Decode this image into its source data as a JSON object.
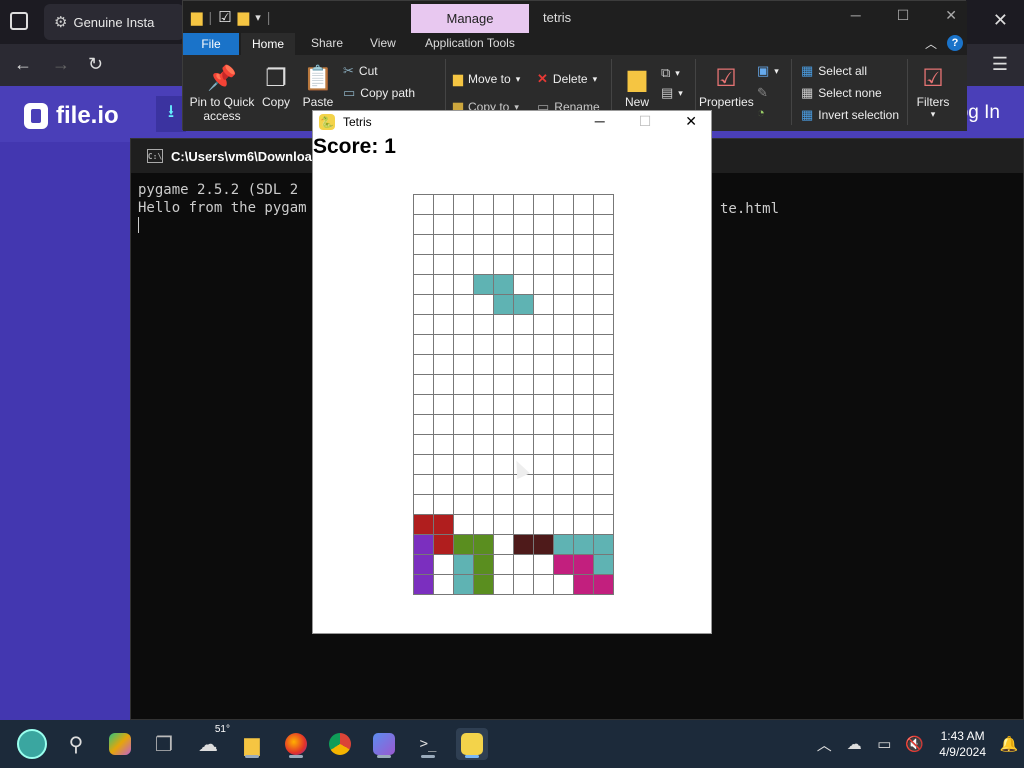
{
  "browser": {
    "tab_title": "Genuine Insta",
    "site_name": "file.io",
    "login_label": "og In"
  },
  "terminal": {
    "title": "C:\\Users\\vm6\\Downloads",
    "icon_label": "C:\\",
    "lines": [
      "pygame 2.5.2 (SDL 2",
      "Hello from the pygam"
    ],
    "tail": "te.html"
  },
  "explorer": {
    "manage_label": "Manage",
    "title": "tetris",
    "tabs": [
      "File",
      "Home",
      "Share",
      "View",
      "Application Tools"
    ],
    "ribbon": {
      "pin_label_1": "Pin to Quick",
      "pin_label_2": "access",
      "copy_label": "Copy",
      "paste_label": "Paste",
      "cut_label": "Cut",
      "copy_path_label": "Copy path",
      "move_to_label": "Move to",
      "copy_to_label": "Copy to",
      "delete_label": "Delete",
      "rename_label": "Rename",
      "new_label": "New",
      "properties_label": "Properties",
      "select_all_label": "Select all",
      "select_none_label": "Select none",
      "invert_selection_label": "Invert selection",
      "filters_label": "Filters"
    }
  },
  "tetris": {
    "window_title": "Tetris",
    "score_text": "Score: 1",
    "rows": 20,
    "cols": 10,
    "colors": {
      "cyan": "#5fb3b3",
      "red": "#b01e1e",
      "purple": "#7b2fbf",
      "green": "#5a8e1f",
      "brown": "#4e1a1a",
      "magenta": "#c21f7e"
    },
    "cells": [
      {
        "r": 4,
        "c": 3,
        "color": "cyan"
      },
      {
        "r": 4,
        "c": 4,
        "color": "cyan"
      },
      {
        "r": 5,
        "c": 4,
        "color": "cyan"
      },
      {
        "r": 5,
        "c": 5,
        "color": "cyan"
      },
      {
        "r": 16,
        "c": 0,
        "color": "red"
      },
      {
        "r": 16,
        "c": 1,
        "color": "red"
      },
      {
        "r": 17,
        "c": 0,
        "color": "purple"
      },
      {
        "r": 17,
        "c": 1,
        "color": "red"
      },
      {
        "r": 17,
        "c": 2,
        "color": "green"
      },
      {
        "r": 17,
        "c": 3,
        "color": "green"
      },
      {
        "r": 17,
        "c": 5,
        "color": "brown"
      },
      {
        "r": 17,
        "c": 6,
        "color": "brown"
      },
      {
        "r": 17,
        "c": 7,
        "color": "cyan"
      },
      {
        "r": 17,
        "c": 8,
        "color": "cyan"
      },
      {
        "r": 17,
        "c": 9,
        "color": "cyan"
      },
      {
        "r": 18,
        "c": 0,
        "color": "purple"
      },
      {
        "r": 18,
        "c": 2,
        "color": "cyan"
      },
      {
        "r": 18,
        "c": 3,
        "color": "green"
      },
      {
        "r": 18,
        "c": 7,
        "color": "magenta"
      },
      {
        "r": 18,
        "c": 8,
        "color": "magenta"
      },
      {
        "r": 18,
        "c": 9,
        "color": "cyan"
      },
      {
        "r": 19,
        "c": 0,
        "color": "purple"
      },
      {
        "r": 19,
        "c": 2,
        "color": "cyan"
      },
      {
        "r": 19,
        "c": 3,
        "color": "green"
      },
      {
        "r": 19,
        "c": 8,
        "color": "magenta"
      },
      {
        "r": 19,
        "c": 9,
        "color": "magenta"
      }
    ]
  },
  "taskbar": {
    "weather_temp": "51°",
    "time": "1:43 AM",
    "date": "4/9/2024"
  }
}
